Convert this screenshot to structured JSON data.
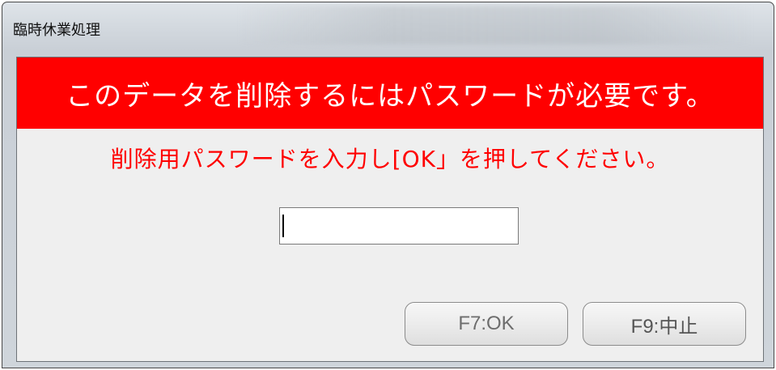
{
  "window": {
    "title": "臨時休業処理"
  },
  "dialog": {
    "banner_text": "このデータを削除するにはパスワードが必要です。",
    "instruction": "削除用パスワードを入力し[OK」を押してください。",
    "password_value": "",
    "ok_label": "F7:OK",
    "cancel_label": "F9:中止"
  },
  "colors": {
    "banner_bg": "#ff0000",
    "banner_text": "#ffffff",
    "instruction_text": "#ff0000",
    "client_bg": "#efefef"
  }
}
